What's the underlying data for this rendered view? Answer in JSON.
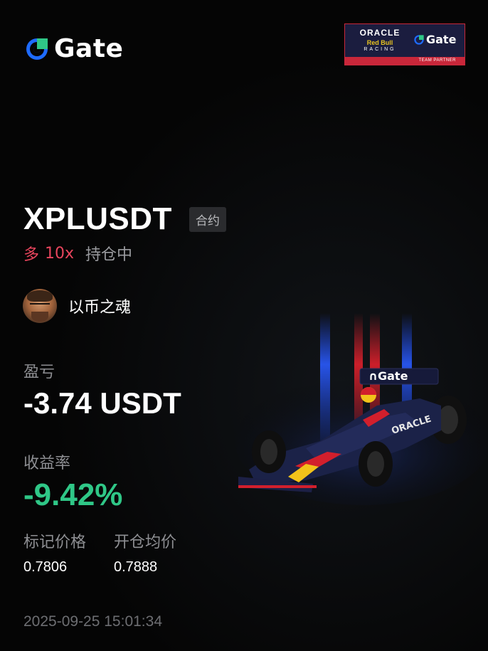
{
  "brand": {
    "logo_text": "Gate",
    "logo_icon": "gate-logo-icon",
    "accent_blue": "#1e6bff",
    "accent_green": "#2fc787"
  },
  "partner_badge": {
    "oracle": "ORACLE",
    "redbull": "Red Bull",
    "racing": "RACING",
    "gate": "Gate",
    "strip": "TEAM PARTNER"
  },
  "position": {
    "symbol": "XPLUSDT",
    "type_tag": "合约",
    "direction": "多",
    "leverage": "10x",
    "status": "持仓中"
  },
  "user": {
    "name": "以币之魂",
    "avatar": "avatar-icon"
  },
  "metrics": {
    "pnl_label": "盈亏",
    "pnl_value": "-3.74 USDT",
    "roi_label": "收益率",
    "roi_value": "-9.42%",
    "mark_price_label": "标记价格",
    "mark_price": "0.7806",
    "entry_price_label": "开仓均价",
    "entry_price": "0.7888"
  },
  "timestamp": "2025-09-25 15:01:34",
  "colors": {
    "long_red": "#e8455d",
    "profit_green": "#2fc787",
    "muted_gray": "#8e8f93"
  }
}
